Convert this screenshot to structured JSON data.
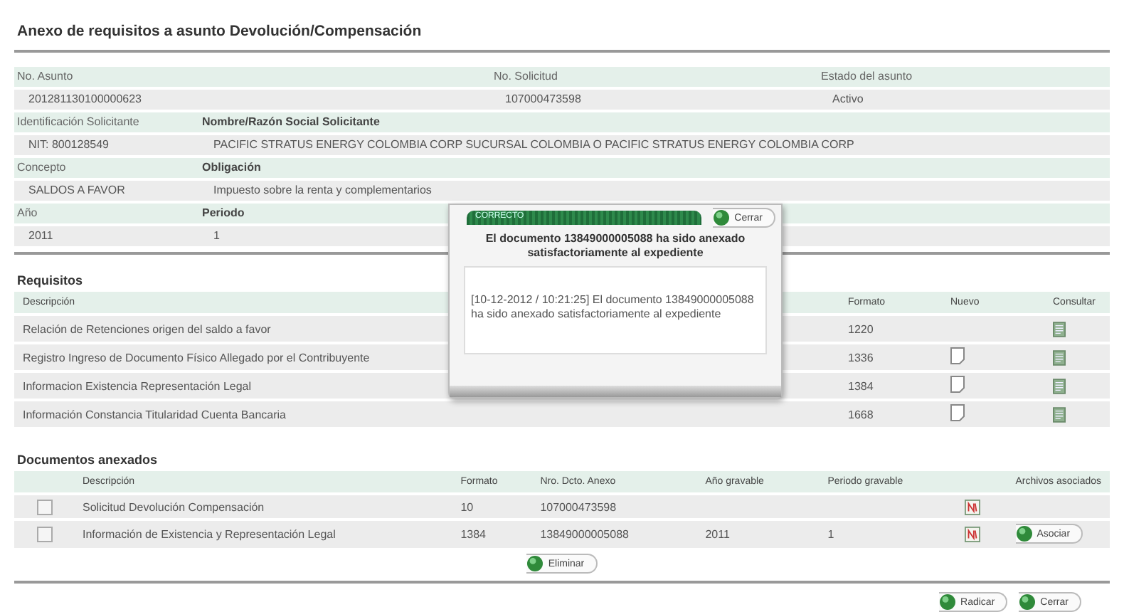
{
  "title": "Anexo de requisitos a asunto Devolución/Compensación",
  "case_info": {
    "rows": [
      [
        {
          "label": "No. Asunto",
          "value": "201281130100000623"
        },
        {
          "label": "No. Solicitud",
          "value": "107000473598"
        },
        {
          "label": "Estado del asunto",
          "value": "Activo"
        }
      ],
      [
        {
          "label": "Identificación Solicitante",
          "value": "NIT: 800128549"
        },
        {
          "label": "Nombre/Razón Social Solicitante",
          "value": "PACIFIC STRATUS ENERGY COLOMBIA CORP SUCURSAL COLOMBIA O PACIFIC STRATUS ENERGY COLOMBIA CORP"
        }
      ],
      [
        {
          "label": "Concepto",
          "value": "SALDOS A FAVOR"
        },
        {
          "label": "Obligación",
          "value": "Impuesto sobre la renta y complementarios"
        }
      ],
      [
        {
          "label": "Año",
          "value": "2011"
        },
        {
          "label": "Periodo",
          "value": "1"
        }
      ]
    ]
  },
  "requirements": {
    "title": "Requisitos",
    "columns": [
      "Descripción",
      "Formato",
      "Nuevo",
      "Consultar"
    ],
    "rows": [
      {
        "description": "Relación de Retenciones origen del saldo a favor",
        "format": "1220",
        "new_available": false
      },
      {
        "description": "Registro Ingreso de Documento Físico Allegado por el Contribuyente",
        "format": "1336",
        "new_available": true
      },
      {
        "description": "Informacion Existencia Representación Legal",
        "format": "1384",
        "new_available": true
      },
      {
        "description": "Información Constancia Titularidad Cuenta Bancaria",
        "format": "1668",
        "new_available": true
      }
    ]
  },
  "attached_documents": {
    "title": "Documentos anexados",
    "columns": [
      "Descripción",
      "Formato",
      "Nro. Dcto. Anexo",
      "Año gravable",
      "Periodo gravable",
      "Archivos asociados"
    ],
    "rows": [
      {
        "checked": false,
        "description": "Solicitud Devolución Compensación",
        "format": "10",
        "number": "107000473598",
        "year": "",
        "period": ""
      },
      {
        "checked": false,
        "description": "Información de Existencia y Representación Legal",
        "format": "1384",
        "number": "13849000005088",
        "year": "2011",
        "period": "1",
        "attach_button": "Asociar"
      }
    ],
    "delete_button": "Eliminar"
  },
  "footer_buttons": [
    "Radicar",
    "Cerrar"
  ],
  "dialog": {
    "status": "CORRECTO",
    "close_button": "Cerrar",
    "message": "El documento 13849000005088 ha sido anexado satisfactoriamente al expediente",
    "log": "[10-12-2012 / 10:21:25] El documento 13849000005088 ha sido anexado satisfactoriamente al expediente"
  }
}
